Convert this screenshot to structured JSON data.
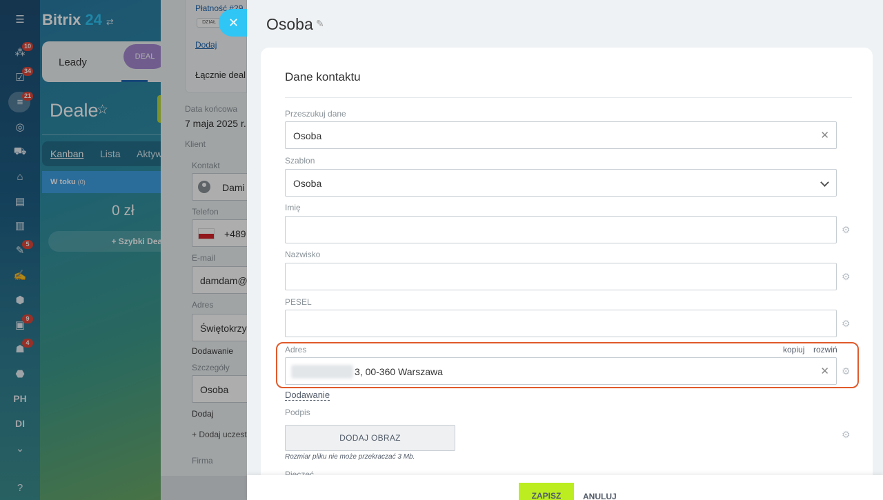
{
  "left_rail": {
    "menu_icon": "hamburger-icon",
    "items": [
      {
        "icon": "chat-icon",
        "badge": "10"
      },
      {
        "icon": "tasks-icon",
        "badge": "34"
      },
      {
        "icon": "crm-icon",
        "badge": "21"
      },
      {
        "icon": "target-icon",
        "badge": ""
      },
      {
        "icon": "cart-icon",
        "badge": ""
      },
      {
        "icon": "bank-icon",
        "badge": ""
      },
      {
        "icon": "clipboard-icon",
        "badge": ""
      },
      {
        "icon": "analytics-icon",
        "badge": ""
      },
      {
        "icon": "document-icon",
        "badge": "5"
      },
      {
        "icon": "signature-icon",
        "badge": ""
      },
      {
        "icon": "hexagon-icon",
        "badge": ""
      },
      {
        "icon": "contacts-icon",
        "badge": "9"
      },
      {
        "icon": "robot-icon",
        "badge": "4"
      },
      {
        "icon": "box-icon",
        "badge": ""
      }
    ],
    "text_items": [
      "PH",
      "DI"
    ],
    "more_icon": "chevron-down-icon",
    "help_icon": "help-icon"
  },
  "background_app": {
    "logo_text": "Bitrix",
    "logo_number": "24",
    "tabs": {
      "leady": "Leady",
      "deal_chip": "DEAL"
    },
    "page_title": "Deale",
    "views": [
      "Kanban",
      "Lista",
      "Aktyw"
    ],
    "column": {
      "title": "W toku",
      "count": "(0)",
      "sum": "0 zł"
    },
    "quick_deal": "+ Szybki Deal"
  },
  "middle_panel": {
    "payment": "Płatność #29",
    "chip": "DZIAŁ",
    "add_link": "Dodaj",
    "total": "Łącznie deal",
    "end_date_label": "Data końcowa",
    "end_date": "7 maja 2025 r.",
    "client_label": "Klient",
    "contact_label": "Kontakt",
    "contact_value": "Dami",
    "phone_label": "Telefon",
    "phone_value": "+489",
    "email_label": "E-mail",
    "email_value": "damdam@",
    "address_label": "Adres",
    "address_value": "Świętokrzys",
    "adding": "Dodawanie",
    "details_label": "Szczegóły",
    "details_value": "Osoba",
    "add2": "Dodaj",
    "add_participant": "+ Dodaj uczest",
    "company_label": "Firma"
  },
  "slider": {
    "title": "Osoba",
    "card_title": "Dane kontaktu",
    "fields": {
      "search": {
        "label": "Przeszukuj dane",
        "value": "Osoba"
      },
      "template": {
        "label": "Szablon",
        "value": "Osoba"
      },
      "first_name": {
        "label": "Imię",
        "value": ""
      },
      "last_name": {
        "label": "Nazwisko",
        "value": ""
      },
      "pesel": {
        "label": "PESEL",
        "value": ""
      },
      "address": {
        "label": "Adres",
        "value": "3, 00-360 Warszawa",
        "copy": "kopiuj",
        "expand": "rozwiń"
      }
    },
    "adding_link": "Dodawanie",
    "signature_label": "Podpis",
    "add_image": "DODAJ OBRAZ",
    "file_note": "Rozmiar pliku nie może przekraczać 3 Mb.",
    "stamp_label": "Pieczęć",
    "footer": {
      "save": "ZAPISZ",
      "cancel": "ANULUJ"
    }
  },
  "colors": {
    "accent": "#2fc6f6",
    "save_button": "#bbed21",
    "highlight": "#e05a2b"
  }
}
